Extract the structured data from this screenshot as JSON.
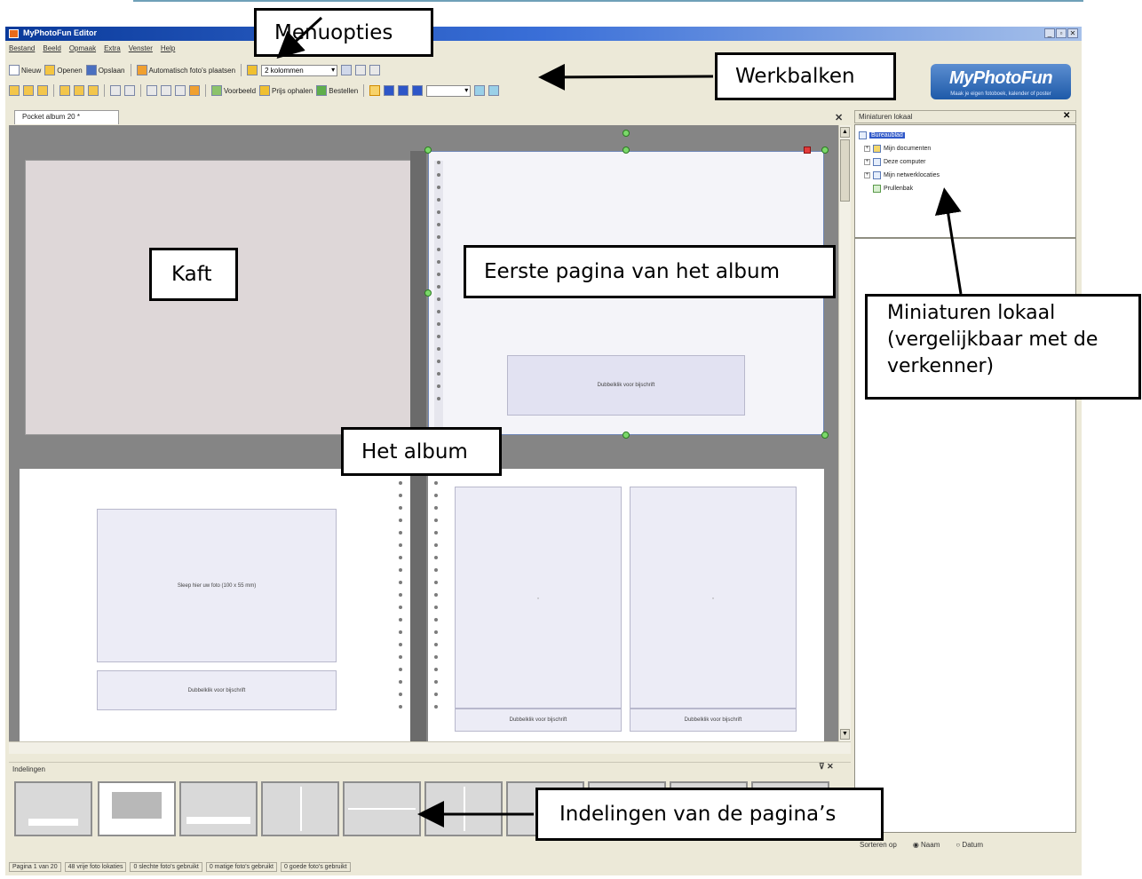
{
  "window": {
    "title": "MyPhotoFun Editor",
    "controls": [
      "_",
      "▫",
      "✕"
    ]
  },
  "menu": [
    "Bestand",
    "Beeld",
    "Opmaak",
    "Extra",
    "Venster",
    "Help"
  ],
  "toolbar1": {
    "new": "Nieuw",
    "open": "Openen",
    "save": "Opslaan",
    "auto_place": "Automatisch foto's plaatsen",
    "columns": "2 kolommen"
  },
  "toolbar2": {
    "preview": "Voorbeeld",
    "get_price": "Prijs ophalen",
    "order": "Bestellen"
  },
  "logo": {
    "text": "MyPhotoFun",
    "tagline": "Maak je eigen fotoboek, kalender of poster"
  },
  "document_tab": "Pocket album 20 *",
  "canvas": {
    "caption_hint": "Dubbelklik voor bijschrift",
    "photo_hint": "Sleep hier uw foto (100 x 55 mm)"
  },
  "side_panel": {
    "title": "Miniaturen lokaal",
    "tree": [
      "Bureaublad",
      "Mijn documenten",
      "Deze computer",
      "Mijn netwerklocaties",
      "Prullenbak"
    ],
    "sort_label": "Sorteren op",
    "sort_name": "Naam",
    "sort_date": "Datum"
  },
  "layouts_panel": {
    "title": "Indelingen"
  },
  "status": [
    "Pagina 1 van 20",
    "48 vrije foto lokaties",
    "0 slechte foto's gebruikt",
    "0 matige foto's gebruikt",
    "0 goede foto's gebruikt"
  ],
  "callouts": {
    "menuopties": "Menuopties",
    "werkbalken": "Werkbalken",
    "kaft": "Kaft",
    "eerste_pagina": "Eerste pagina van het album",
    "miniaturen": "Miniaturen lokaal (vergelijkbaar met de verkenner)",
    "het_album": "Het album",
    "indelingen": "Indelingen van de pagina’s"
  },
  "colors": {
    "title_bar": "#0a3a9a",
    "workspace": "#858585",
    "selection_handle": "#7bd86a",
    "page_border": "#6f86b6"
  }
}
